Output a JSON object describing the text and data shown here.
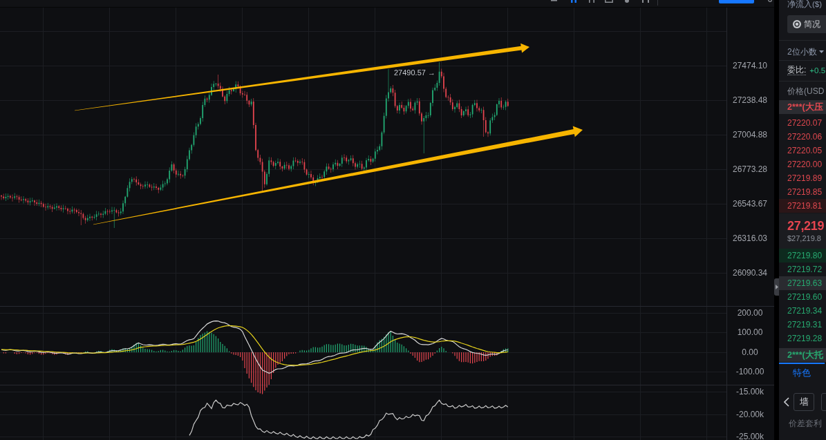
{
  "chart": {
    "high_label": "27490.57 →",
    "price_axis": [
      "27474.10",
      "27238.48",
      "27004.88",
      "26773.28",
      "26543.67",
      "26316.03",
      "26090.34"
    ],
    "macd_axis": [
      "200.00",
      "100.00",
      "0.00",
      "-100.00"
    ],
    "indicator_axis": [
      "-15.00k",
      "-20.00k",
      "-25.00k"
    ]
  },
  "order_book": {
    "net_inflow_label": "净流入($)",
    "overview_button": "简况",
    "precision": "2位小数",
    "ratio_label": "委比:",
    "ratio_value": "+0.5",
    "price_header": "价格(USD",
    "asks": [
      {
        "kind": "wall",
        "price": "2***(大压",
        "highlighted": false,
        "hovered": false
      },
      {
        "kind": "price",
        "price": "27220.07",
        "highlighted": false,
        "hovered": false
      },
      {
        "kind": "price",
        "price": "27220.06",
        "highlighted": false,
        "hovered": false
      },
      {
        "kind": "price",
        "price": "27220.05",
        "highlighted": false,
        "hovered": false
      },
      {
        "kind": "price",
        "price": "27220.00",
        "highlighted": false,
        "hovered": false
      },
      {
        "kind": "price",
        "price": "27219.89",
        "highlighted": false,
        "hovered": false
      },
      {
        "kind": "price",
        "price": "27219.85",
        "highlighted": false,
        "hovered": false
      },
      {
        "kind": "price",
        "price": "27219.81",
        "highlighted": true,
        "hovered": false
      }
    ],
    "last_price": "27,219",
    "last_price_usd": "$27,219.8",
    "bids": [
      {
        "kind": "price",
        "price": "27219.80",
        "highlighted": true,
        "hovered": false
      },
      {
        "kind": "price",
        "price": "27219.72",
        "highlighted": false,
        "hovered": false
      },
      {
        "kind": "price",
        "price": "27219.63",
        "highlighted": false,
        "hovered": true
      },
      {
        "kind": "price",
        "price": "27219.60",
        "highlighted": false,
        "hovered": false
      },
      {
        "kind": "price",
        "price": "27219.34",
        "highlighted": false,
        "hovered": false
      },
      {
        "kind": "price",
        "price": "27219.31",
        "highlighted": false,
        "hovered": false
      },
      {
        "kind": "price",
        "price": "27219.28",
        "highlighted": false,
        "hovered": false
      },
      {
        "kind": "wall",
        "price": "2***(大托",
        "highlighted": false,
        "hovered": false
      }
    ],
    "tabs": [
      {
        "label": "特色",
        "selected": true
      }
    ],
    "chips": [
      {
        "label": "墙"
      }
    ],
    "footer": "价差套利"
  }
}
